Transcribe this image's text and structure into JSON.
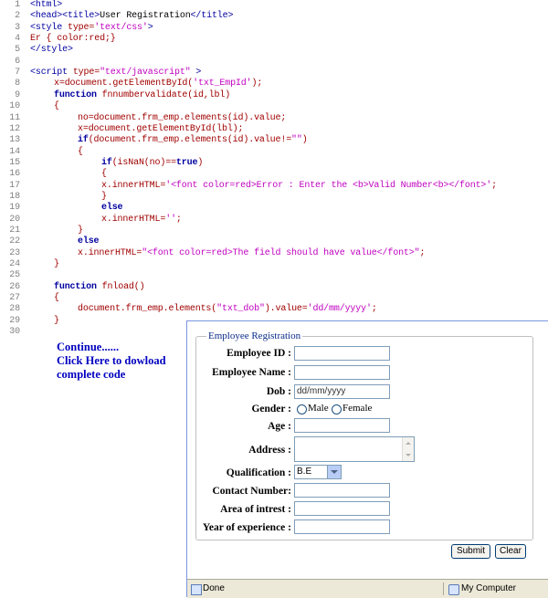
{
  "code": {
    "lines": [
      {
        "n": "1",
        "indent": 0,
        "parts": [
          {
            "c": "t",
            "t": "<html>"
          }
        ]
      },
      {
        "n": "2",
        "indent": 0,
        "parts": [
          {
            "c": "t",
            "t": "<head><title>"
          },
          {
            "c": "",
            "t": "User Registration"
          },
          {
            "c": "t",
            "t": "</title>"
          }
        ]
      },
      {
        "n": "3",
        "indent": 0,
        "parts": [
          {
            "c": "t",
            "t": "<style "
          },
          {
            "c": "r",
            "t": "type="
          },
          {
            "c": "s",
            "t": "'text/css'"
          },
          {
            "c": "t",
            "t": ">"
          }
        ]
      },
      {
        "n": "4",
        "indent": 0,
        "parts": [
          {
            "c": "r",
            "t": "Er { color:red;}"
          }
        ]
      },
      {
        "n": "5",
        "indent": 0,
        "parts": [
          {
            "c": "t",
            "t": "</style>"
          }
        ]
      },
      {
        "n": "6",
        "indent": 0,
        "parts": []
      },
      {
        "n": "7",
        "indent": 0,
        "parts": [
          {
            "c": "t",
            "t": "<script "
          },
          {
            "c": "r",
            "t": "type="
          },
          {
            "c": "s",
            "t": "\"text/javascript\""
          },
          {
            "c": "t",
            "t": " >"
          }
        ]
      },
      {
        "n": "8",
        "indent": 1,
        "parts": [
          {
            "c": "r",
            "t": "x=document.getElementById("
          },
          {
            "c": "s",
            "t": "'txt_EmpId'"
          },
          {
            "c": "r",
            "t": ");"
          }
        ]
      },
      {
        "n": "9",
        "indent": 1,
        "parts": [
          {
            "c": "k",
            "t": "function"
          },
          {
            "c": "r",
            "t": " fnnumbervalidate(id,lbl)"
          }
        ]
      },
      {
        "n": "10",
        "indent": 1,
        "parts": [
          {
            "c": "r",
            "t": "{"
          }
        ]
      },
      {
        "n": "11",
        "indent": 2,
        "parts": [
          {
            "c": "r",
            "t": "no=document.frm_emp.elements(id).value;"
          }
        ]
      },
      {
        "n": "12",
        "indent": 2,
        "parts": [
          {
            "c": "r",
            "t": "x=document.getElementById(lbl);"
          }
        ]
      },
      {
        "n": "13",
        "indent": 2,
        "parts": [
          {
            "c": "k",
            "t": "if"
          },
          {
            "c": "r",
            "t": "(document.frm_emp.elements(id).value!="
          },
          {
            "c": "s",
            "t": "\"\""
          },
          {
            "c": "r",
            "t": ")"
          }
        ]
      },
      {
        "n": "14",
        "indent": 2,
        "parts": [
          {
            "c": "r",
            "t": "{"
          }
        ]
      },
      {
        "n": "15",
        "indent": 3,
        "parts": [
          {
            "c": "k",
            "t": "if"
          },
          {
            "c": "r",
            "t": "(isNaN(no)=="
          },
          {
            "c": "k",
            "t": "true"
          },
          {
            "c": "r",
            "t": ")"
          }
        ]
      },
      {
        "n": "16",
        "indent": 3,
        "parts": [
          {
            "c": "r",
            "t": "{"
          }
        ]
      },
      {
        "n": "17",
        "indent": 3,
        "parts": [
          {
            "c": "r",
            "t": "x.innerHTML="
          },
          {
            "c": "s",
            "t": "'<font color=red>Error : Enter the <b>Valid Number<b></font>'"
          },
          {
            "c": "r",
            "t": ";"
          }
        ]
      },
      {
        "n": "18",
        "indent": 3,
        "parts": [
          {
            "c": "r",
            "t": "}"
          }
        ]
      },
      {
        "n": "19",
        "indent": 3,
        "parts": [
          {
            "c": "k",
            "t": "else"
          }
        ]
      },
      {
        "n": "20",
        "indent": 3,
        "parts": [
          {
            "c": "r",
            "t": "x.innerHTML="
          },
          {
            "c": "s",
            "t": "''"
          },
          {
            "c": "r",
            "t": ";"
          }
        ]
      },
      {
        "n": "21",
        "indent": 2,
        "parts": [
          {
            "c": "r",
            "t": "}"
          }
        ]
      },
      {
        "n": "22",
        "indent": 2,
        "parts": [
          {
            "c": "k",
            "t": "else"
          }
        ]
      },
      {
        "n": "23",
        "indent": 2,
        "parts": [
          {
            "c": "r",
            "t": "x.innerHTML="
          },
          {
            "c": "s",
            "t": "\"<font color=red>The field should have value</font>\""
          },
          {
            "c": "r",
            "t": ";"
          }
        ]
      },
      {
        "n": "24",
        "indent": 1,
        "parts": [
          {
            "c": "r",
            "t": "}"
          }
        ]
      },
      {
        "n": "25",
        "indent": 0,
        "parts": []
      },
      {
        "n": "26",
        "indent": 1,
        "parts": [
          {
            "c": "k",
            "t": "function"
          },
          {
            "c": "r",
            "t": " fnload()"
          }
        ]
      },
      {
        "n": "27",
        "indent": 1,
        "parts": [
          {
            "c": "r",
            "t": "{"
          }
        ]
      },
      {
        "n": "28",
        "indent": 2,
        "parts": [
          {
            "c": "r",
            "t": "document.frm_emp.elements("
          },
          {
            "c": "s",
            "t": "\"txt_dob\""
          },
          {
            "c": "r",
            "t": ").value="
          },
          {
            "c": "s",
            "t": "'dd/mm/yyyy'"
          },
          {
            "c": "r",
            "t": ";"
          }
        ]
      },
      {
        "n": "29",
        "indent": 1,
        "parts": [
          {
            "c": "r",
            "t": "}"
          }
        ]
      },
      {
        "n": "30",
        "indent": 0,
        "parts": []
      }
    ]
  },
  "continue_link": {
    "line1": "Continue......",
    "line2": "Click Here to dowload",
    "line3": "complete code"
  },
  "form": {
    "legend": "Employee Registration",
    "employee_id_label": "Employee ID :",
    "employee_name_label": "Employee Name :",
    "dob_label": "Dob :",
    "dob_value": "dd/mm/yyyy",
    "gender_label": "Gender :",
    "gender_male": "Male",
    "gender_female": "Female",
    "age_label": "Age :",
    "address_label": "Address :",
    "qualification_label": "Qualification :",
    "qualification_value": "B.E",
    "contact_label": "Contact Number:",
    "area_label": "Area of intrest :",
    "experience_label": "Year of experience :",
    "submit_label": "Submit",
    "clear_label": "Clear"
  },
  "statusbar": {
    "status_text": "Done",
    "zone_text": "My Computer"
  },
  "colors": {
    "code_tag": "#0000a0",
    "code_text": "#a00000",
    "code_string": "#c000c0",
    "link": "#0000c0"
  }
}
